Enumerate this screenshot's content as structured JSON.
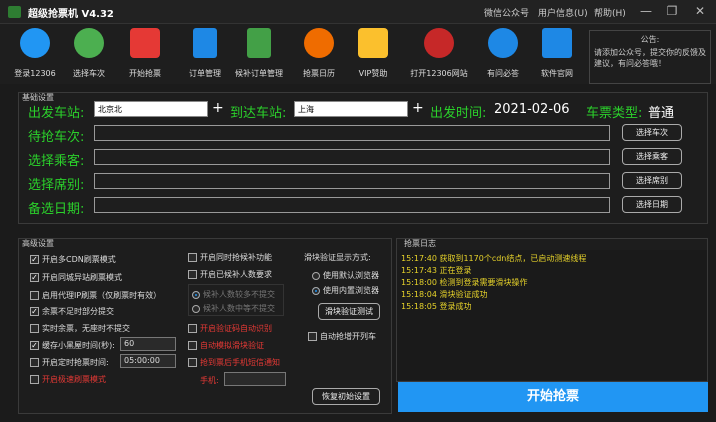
{
  "window": {
    "title": "超级抢票机 V4.32",
    "menu": [
      "微信公众号",
      "用户信息(U)",
      "帮助(H)"
    ],
    "controls": [
      "—",
      "❐",
      "✕"
    ]
  },
  "toolbar": {
    "items": [
      {
        "label": "登录12306",
        "icon": "user-login-icon",
        "color": "#2196f3"
      },
      {
        "label": "选择车次",
        "icon": "train-icon",
        "color": "#4caf50"
      },
      {
        "label": "开始抢票",
        "icon": "ticket-grab-icon",
        "color": "#e53935"
      },
      {
        "label": "订单管理",
        "icon": "order-document-icon",
        "color": "#1e88e5"
      },
      {
        "label": "候补订单管理",
        "icon": "standby-order-icon",
        "color": "#43a047"
      },
      {
        "label": "抢票日历",
        "icon": "calendar-dollar-icon",
        "color": "#ef6c00"
      },
      {
        "label": "VIP赞助",
        "icon": "vip-crown-icon",
        "color": "#fbc02d"
      },
      {
        "label": "打开12306网站",
        "icon": "railway-logo-icon",
        "color": "#c62828"
      },
      {
        "label": "有问必答",
        "icon": "help-question-icon",
        "color": "#1e88e5"
      },
      {
        "label": "软件官网",
        "icon": "home-icon",
        "color": "#1e88e5"
      }
    ]
  },
  "notice": {
    "title": "公告:",
    "text": "请添加公众号，提交你的反馈及建议，有问必答哦！"
  },
  "basic": {
    "section_title": "基础设置",
    "from_label": "出发车站:",
    "from_value": "北京北",
    "to_label": "到达车站:",
    "to_value": "上海",
    "plus": "+",
    "date_label": "出发时间:",
    "date_value": "2021-02-06",
    "seat_type_label": "车票类型:",
    "seat_type_value": "普通",
    "trains_label": "待抢车次:",
    "trains_button": "选择车次",
    "passengers_label": "选择乘客:",
    "passengers_button": "选择乘客",
    "seats_label": "选择席别:",
    "seats_button": "选择席别",
    "backup_label": "备选日期:",
    "backup_button": "选择日期"
  },
  "advanced": {
    "section_title": "高级设置",
    "col1": [
      {
        "label": "开启多CDN刷票模式",
        "checked": true,
        "style": "normal"
      },
      {
        "label": "开启同城异站刷票模式",
        "checked": true,
        "style": "normal"
      },
      {
        "label": "启用代理IP刷票（仅刷票时有效）",
        "checked": false,
        "style": "normal"
      },
      {
        "label": "余票不足时部分提交",
        "checked": true,
        "style": "normal"
      },
      {
        "label": "实时余票，无座时不提交",
        "checked": false,
        "style": "normal"
      },
      {
        "label": "缓存小黑屋时间(秒):",
        "checked": true,
        "style": "normal"
      },
      {
        "label": "开启定时抢票时间:",
        "checked": false,
        "style": "normal"
      },
      {
        "label": "开启极速刷票模式",
        "checked": false,
        "style": "red"
      }
    ],
    "blackroom_value": "60",
    "timer_value": "05:00:00",
    "col2": [
      {
        "label": "开启同时抢候补功能",
        "checked": false,
        "style": "normal"
      },
      {
        "label": "开启已候补人数要求",
        "checked": false,
        "style": "normal"
      },
      {
        "label": "候补人数较多不提交",
        "checked": true,
        "style": "dim"
      },
      {
        "label": "候补人数中等不提交",
        "checked": false,
        "style": "dim"
      },
      {
        "label": "开启验证码自动识别",
        "checked": false,
        "style": "red"
      },
      {
        "label": "自动模拟滑块验证",
        "checked": false,
        "style": "red"
      },
      {
        "label": "抢到票后手机短信通知",
        "checked": false,
        "style": "red"
      }
    ],
    "phone_label": "手机:",
    "phone_value": "",
    "slider_title": "滑块验证显示方式:",
    "slider_options": [
      {
        "label": "使用默认浏览器",
        "selected": false
      },
      {
        "label": "使用内置浏览器",
        "selected": true
      }
    ],
    "slider_test_button": "滑块验证测试",
    "auto_list": {
      "label": "自动抢增开列车",
      "checked": false
    },
    "reset_button": "恢复初始设置"
  },
  "log": {
    "section_title": "抢票日志",
    "lines": [
      "15:17:40 获取到1170个cdn结点，已启动测速线程",
      "15:17:43 正在登录",
      "15:18:00 检测到登录需要滑块操作",
      "15:18:04 滑块验证成功",
      "15:18:05 登录成功"
    ]
  },
  "start_button": "开始抢票"
}
